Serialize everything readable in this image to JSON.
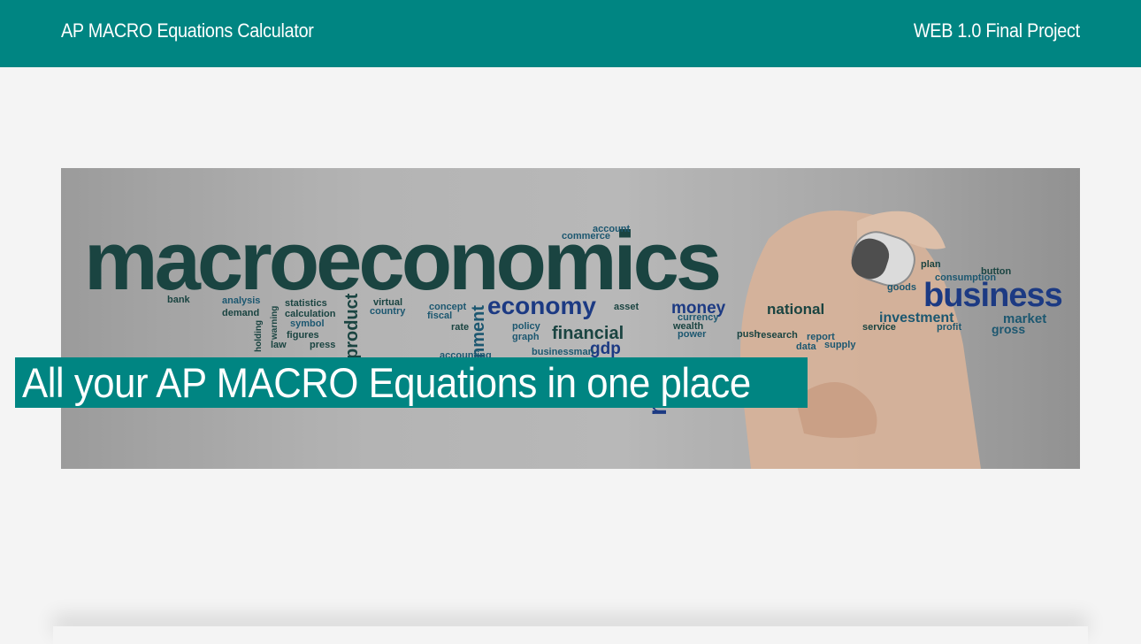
{
  "header": {
    "brand": "AP MACRO Equations Calculator",
    "nav_link": "WEB 1.0 Final Project"
  },
  "hero": {
    "tagline": "All your AP MACRO Equations in one place",
    "image_words": {
      "main": "macroeconomics",
      "business": "business",
      "economy": "economy",
      "financial": "financial",
      "gdp": "gdp",
      "money": "money",
      "national": "national",
      "investment": "investment",
      "market": "market",
      "gross": "gross",
      "commerce": "commerce",
      "account": "account",
      "bank": "bank",
      "analysis": "analysis",
      "demand": "demand",
      "statistics": "statistics",
      "calculation": "calculation",
      "symbol": "symbol",
      "figures": "figures",
      "law": "law",
      "press": "press",
      "virtual": "virtual",
      "country": "country",
      "concept": "concept",
      "fiscal": "fiscal",
      "rate": "rate",
      "policy": "policy",
      "graph": "graph",
      "asset": "asset",
      "currency": "currency",
      "wealth": "wealth",
      "power": "power",
      "push": "push",
      "research": "research",
      "report": "report",
      "data": "data",
      "supply": "supply",
      "plan": "plan",
      "goods": "goods",
      "button": "button",
      "consumption": "consumption",
      "profit": "profit",
      "service": "service",
      "product": "product",
      "finance": "nce",
      "government": "nment",
      "holding": "holding",
      "warning": "warning",
      "businessman": "businessman",
      "accounting": "accounting"
    }
  },
  "colors": {
    "accent": "#008582",
    "background": "#f4f4f4",
    "text_on_accent": "#ffffff"
  }
}
